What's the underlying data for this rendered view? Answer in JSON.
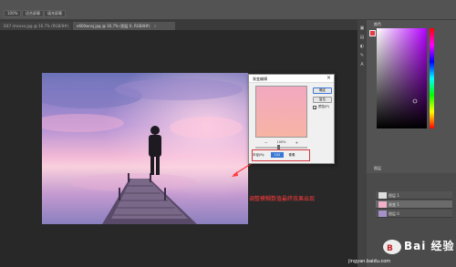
{
  "options_bar": {
    "zoom": "100%",
    "btn_fit": "适合屏幕",
    "btn_fill": "填充屏幕"
  },
  "tabs": [
    {
      "label": "D47 rmsxxx.jpg @ 16.7% (RGB/8#)",
      "close": "×"
    },
    {
      "label": "e600wnsj.jpg @ 16.7% (图层 0, RGB/8#)",
      "close": "×"
    }
  ],
  "right_panel": {
    "color_tab": "颜色",
    "layers_tab": "图层",
    "layer_rows": [
      {
        "name": "图层 1"
      },
      {
        "name": "渐变 1"
      },
      {
        "name": "图层 0"
      }
    ]
  },
  "dialog": {
    "title": "渐变编辑",
    "close": "×",
    "ok": "确定",
    "cancel": "复位",
    "preview_check": "✓",
    "preview_label": "预览(P)",
    "zoom_text": "100%",
    "zoom_out_icon": "−",
    "zoom_in_icon": "+",
    "value_label": "半径(R):",
    "value": "102",
    "value_unit": "像素",
    "gradient_top": "#f2a8c0",
    "gradient_bottom": "#f7b4a4"
  },
  "annotation": {
    "text": "调整模糊数值最终效果出现",
    "color": "#ff3a3a"
  },
  "watermark": {
    "brand": "Bai 经验",
    "url": "jingyan.baidu.com"
  },
  "colors": {
    "foreground": "#e43c45",
    "accent": "#3978d6"
  }
}
